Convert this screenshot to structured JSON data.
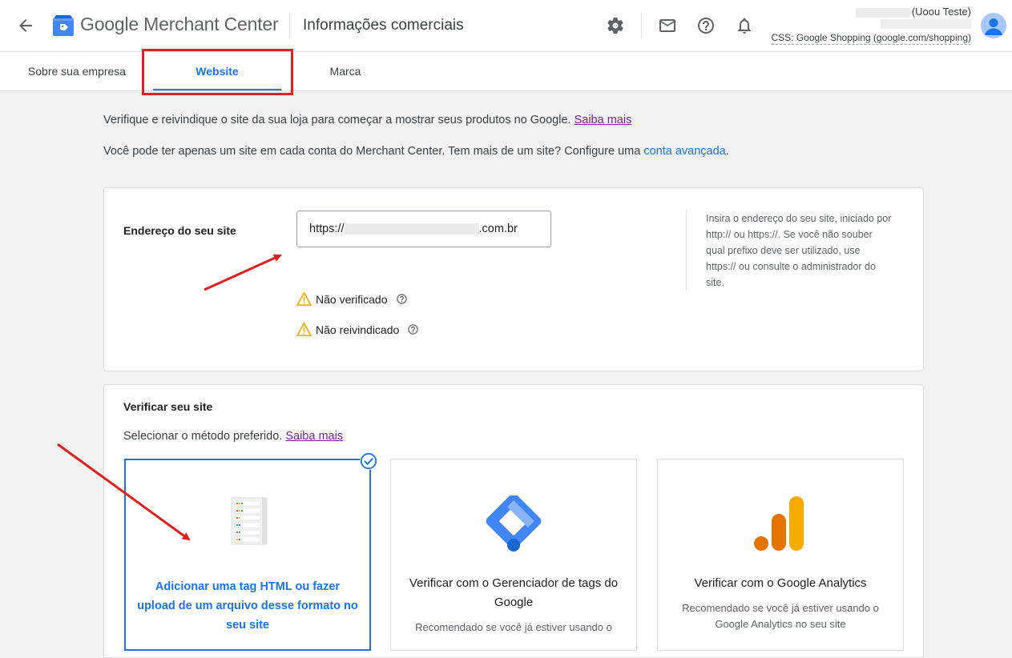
{
  "header": {
    "brand_google": "Google",
    "brand_product": "Merchant Center",
    "page_title": "Informações comerciais",
    "account_name": "(Uoou Teste)",
    "css_label": "CSS: Google Shopping (google.com/shopping)"
  },
  "tabs": [
    {
      "label": "Sobre sua empresa",
      "active": false
    },
    {
      "label": "Website",
      "active": true
    },
    {
      "label": "Marca",
      "active": false
    }
  ],
  "intro": {
    "line1": "Verifique e reivindique o site da sua loja para começar a mostrar seus produtos no Google.",
    "line1_link": "Saiba mais",
    "line2": "Você pode ter apenas um site em cada conta do Merchant Center. Tem mais de um site? Configure uma",
    "line2_link": "conta avançada",
    "line2_end": "."
  },
  "website_card": {
    "label": "Endereço do seu site",
    "url_prefix": "https://",
    "url_suffix": ".com.br",
    "hint": "Insira o endereço do seu site, iniciado por http:// ou https://. Se você não souber qual prefixo deve ser utilizado, use https:// ou consulte o administrador do site.",
    "status_verified": "Não verificado",
    "status_claimed": "Não reivindicado"
  },
  "verify_card": {
    "title": "Verificar seu site",
    "prompt": "Selecionar o método preferido.",
    "prompt_link": "Saiba mais",
    "methods": [
      {
        "title": "Adicionar uma tag HTML ou fazer upload de um arquivo desse formato no seu site",
        "desc": "",
        "selected": true,
        "icon": "html-file-icon"
      },
      {
        "title": "Verificar com o Gerenciador de tags do Google",
        "desc": "Recomendado se você já estiver usando o",
        "selected": false,
        "icon": "google-tag-manager-icon"
      },
      {
        "title": "Verificar com o Google Analytics",
        "desc": "Recomendado se você já estiver usando o Google Analytics no seu site",
        "selected": false,
        "icon": "google-analytics-icon"
      }
    ]
  },
  "colors": {
    "accent": "#1a73e8",
    "warning": "#f9ab00",
    "annotation": "#e02020",
    "link_visited": "#7b1fa2"
  }
}
